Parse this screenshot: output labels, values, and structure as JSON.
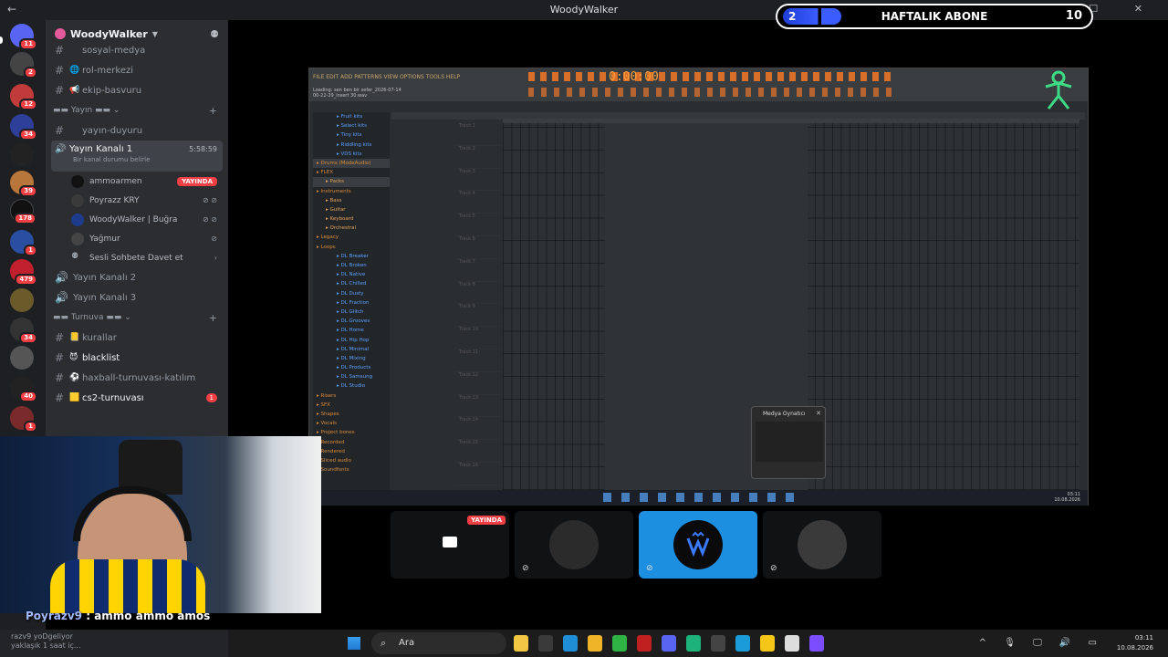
{
  "window": {
    "title": "WoodyWalker",
    "back_glyph": "←",
    "controls": "—  ☐  ✕"
  },
  "overlay": {
    "abone_count": "2",
    "abone_label": "HAFTALIK ABONE",
    "abone_goal": "10"
  },
  "servers": [
    {
      "badge": "11",
      "color": "#5865f2"
    },
    {
      "badge": "2",
      "color": "#444"
    },
    {
      "badge": "12",
      "color": "#c23b3b"
    },
    {
      "badge": "34",
      "color": "#2e3f9a"
    },
    {
      "badge": "",
      "color": "#222"
    },
    {
      "badge": "39",
      "color": "#b8763a"
    },
    {
      "badge": "178",
      "color": "#111"
    },
    {
      "badge": "1",
      "color": "#2a4fa0"
    },
    {
      "badge": "479",
      "color": "#c21f2f"
    },
    {
      "badge": "",
      "color": "#6b5a2a"
    },
    {
      "badge": "34",
      "color": "#333"
    },
    {
      "badge": "",
      "color": "#555"
    },
    {
      "badge": "40",
      "color": "#222"
    },
    {
      "badge": "1",
      "color": "#7a2a2a"
    }
  ],
  "guild": {
    "name": "WoodyWalker"
  },
  "channels": {
    "top": [
      {
        "emoji": "",
        "name": "sosyal-medya"
      },
      {
        "emoji": "🌐",
        "name": "rol-merkezi"
      },
      {
        "emoji": "📢",
        "name": "ekip-basvuru"
      }
    ],
    "cat_yayin": "Yayın",
    "yayin_duyuru": {
      "emoji": "",
      "name": "yayın-duyuru"
    },
    "voice_active": {
      "name": "Yayın Kanalı 1",
      "timer": "5:58:59",
      "sub": "Bir kanal durumu belirle"
    },
    "members": [
      {
        "name": "ammoarmen",
        "live": "YAYINDA"
      },
      {
        "name": "Poyrazz  KRY",
        "live": ""
      },
      {
        "name": "WoodyWalker | Buğra",
        "live": ""
      },
      {
        "name": "Yağmur",
        "live": ""
      },
      {
        "name": "Sesli Sohbete Davet et",
        "live": ""
      }
    ],
    "voice2": "Yayın Kanalı 2",
    "voice3": "Yayın Kanalı 3",
    "cat_turnuva": "Turnuva",
    "turnuva": [
      {
        "emoji": "📒",
        "name": "kurallar",
        "unread": ""
      },
      {
        "emoji": "😈",
        "name": "blacklist",
        "unread": ""
      },
      {
        "emoji": "⚽",
        "name": "haxball-turnuvası-katılım",
        "unread": ""
      },
      {
        "emoji": "🟨",
        "name": "cs2-turnuvası",
        "unread": "1"
      }
    ]
  },
  "fl": {
    "menu": "FILE  EDIT  ADD  PATTERNS  VIEW  OPTIONS  TOOLS  HELP",
    "time": "0:00:00",
    "hint1": "Loading: sen ben bir sefer_2026-07-14",
    "hint2": "00-22-29_insert 30.wav",
    "browser": [
      {
        "t": "Fruit kits",
        "c": "sub2"
      },
      {
        "t": "Select kits",
        "c": "sub2"
      },
      {
        "t": "Tiny kits",
        "c": "sub2"
      },
      {
        "t": "Riddling kits",
        "c": "sub2"
      },
      {
        "t": "VDS kits",
        "c": "sub2"
      },
      {
        "t": "Drums (ModeAudio)",
        "c": "hl"
      },
      {
        "t": "FLEX",
        "c": ""
      },
      {
        "t": "Packs",
        "c": "sub hl"
      },
      {
        "t": "Instruments",
        "c": ""
      },
      {
        "t": "Bass",
        "c": "sub"
      },
      {
        "t": "Guitar",
        "c": "sub"
      },
      {
        "t": "Keyboard",
        "c": "sub"
      },
      {
        "t": "Orchestral",
        "c": "sub"
      },
      {
        "t": "Legacy",
        "c": ""
      },
      {
        "t": "Loops",
        "c": ""
      },
      {
        "t": "DL Breaker",
        "c": "sub2"
      },
      {
        "t": "DL Broken",
        "c": "sub2"
      },
      {
        "t": "DL Native",
        "c": "sub2"
      },
      {
        "t": "DL Chilled",
        "c": "sub2"
      },
      {
        "t": "DL Dusty",
        "c": "sub2"
      },
      {
        "t": "DL Fraction",
        "c": "sub2"
      },
      {
        "t": "DL Glitch",
        "c": "sub2"
      },
      {
        "t": "DL Grooves",
        "c": "sub2"
      },
      {
        "t": "DL Home",
        "c": "sub2"
      },
      {
        "t": "DL Hip Hop",
        "c": "sub2"
      },
      {
        "t": "DL Minimal",
        "c": "sub2"
      },
      {
        "t": "DL Mixing",
        "c": "sub2"
      },
      {
        "t": "DL Products",
        "c": "sub2"
      },
      {
        "t": "DL Samsung",
        "c": "sub2"
      },
      {
        "t": "DL Studio",
        "c": "sub2"
      },
      {
        "t": "Risers",
        "c": ""
      },
      {
        "t": "SFX",
        "c": ""
      },
      {
        "t": "Shapes",
        "c": ""
      },
      {
        "t": "Vocals",
        "c": ""
      },
      {
        "t": "Project bones",
        "c": ""
      },
      {
        "t": "Recorded",
        "c": ""
      },
      {
        "t": "Rendered",
        "c": ""
      },
      {
        "t": "Sliced audio",
        "c": ""
      },
      {
        "t": "Soundfonts",
        "c": ""
      }
    ],
    "tracks": [
      "Track 1",
      "Track 2",
      "Track 3",
      "Track 4",
      "Track 5",
      "Track 6",
      "Track 7",
      "Track 8",
      "Track 9",
      "Track 10",
      "Track 11",
      "Track 12",
      "Track 13",
      "Track 14",
      "Track 15",
      "Track 16"
    ],
    "media_title": "Medya Oynatıcı",
    "stream_clock": "03:11\n10.08.2026"
  },
  "tiles": [
    {
      "live": "YAYINDA"
    },
    {
      "live": ""
    },
    {
      "live": ""
    },
    {
      "live": ""
    }
  ],
  "chat": {
    "user": "Poyrazv9",
    "message": " : ammo ammo amos"
  },
  "userbar": {
    "line1": "razv9 yoDgeliyor",
    "line2": "yaklaşık 1 saat iç..."
  },
  "taskbar": {
    "search": "Ara",
    "time": "03:11",
    "date": "10.08.2026",
    "apps": [
      "#f2c744",
      "#3a3a3a",
      "#1f8ed6",
      "#f0b429",
      "#2fb344",
      "#c02020",
      "#5865f2",
      "#1cb27a",
      "#444",
      "#1b9cd8",
      "#f5c518",
      "#ddd",
      "#7c4dff"
    ]
  }
}
